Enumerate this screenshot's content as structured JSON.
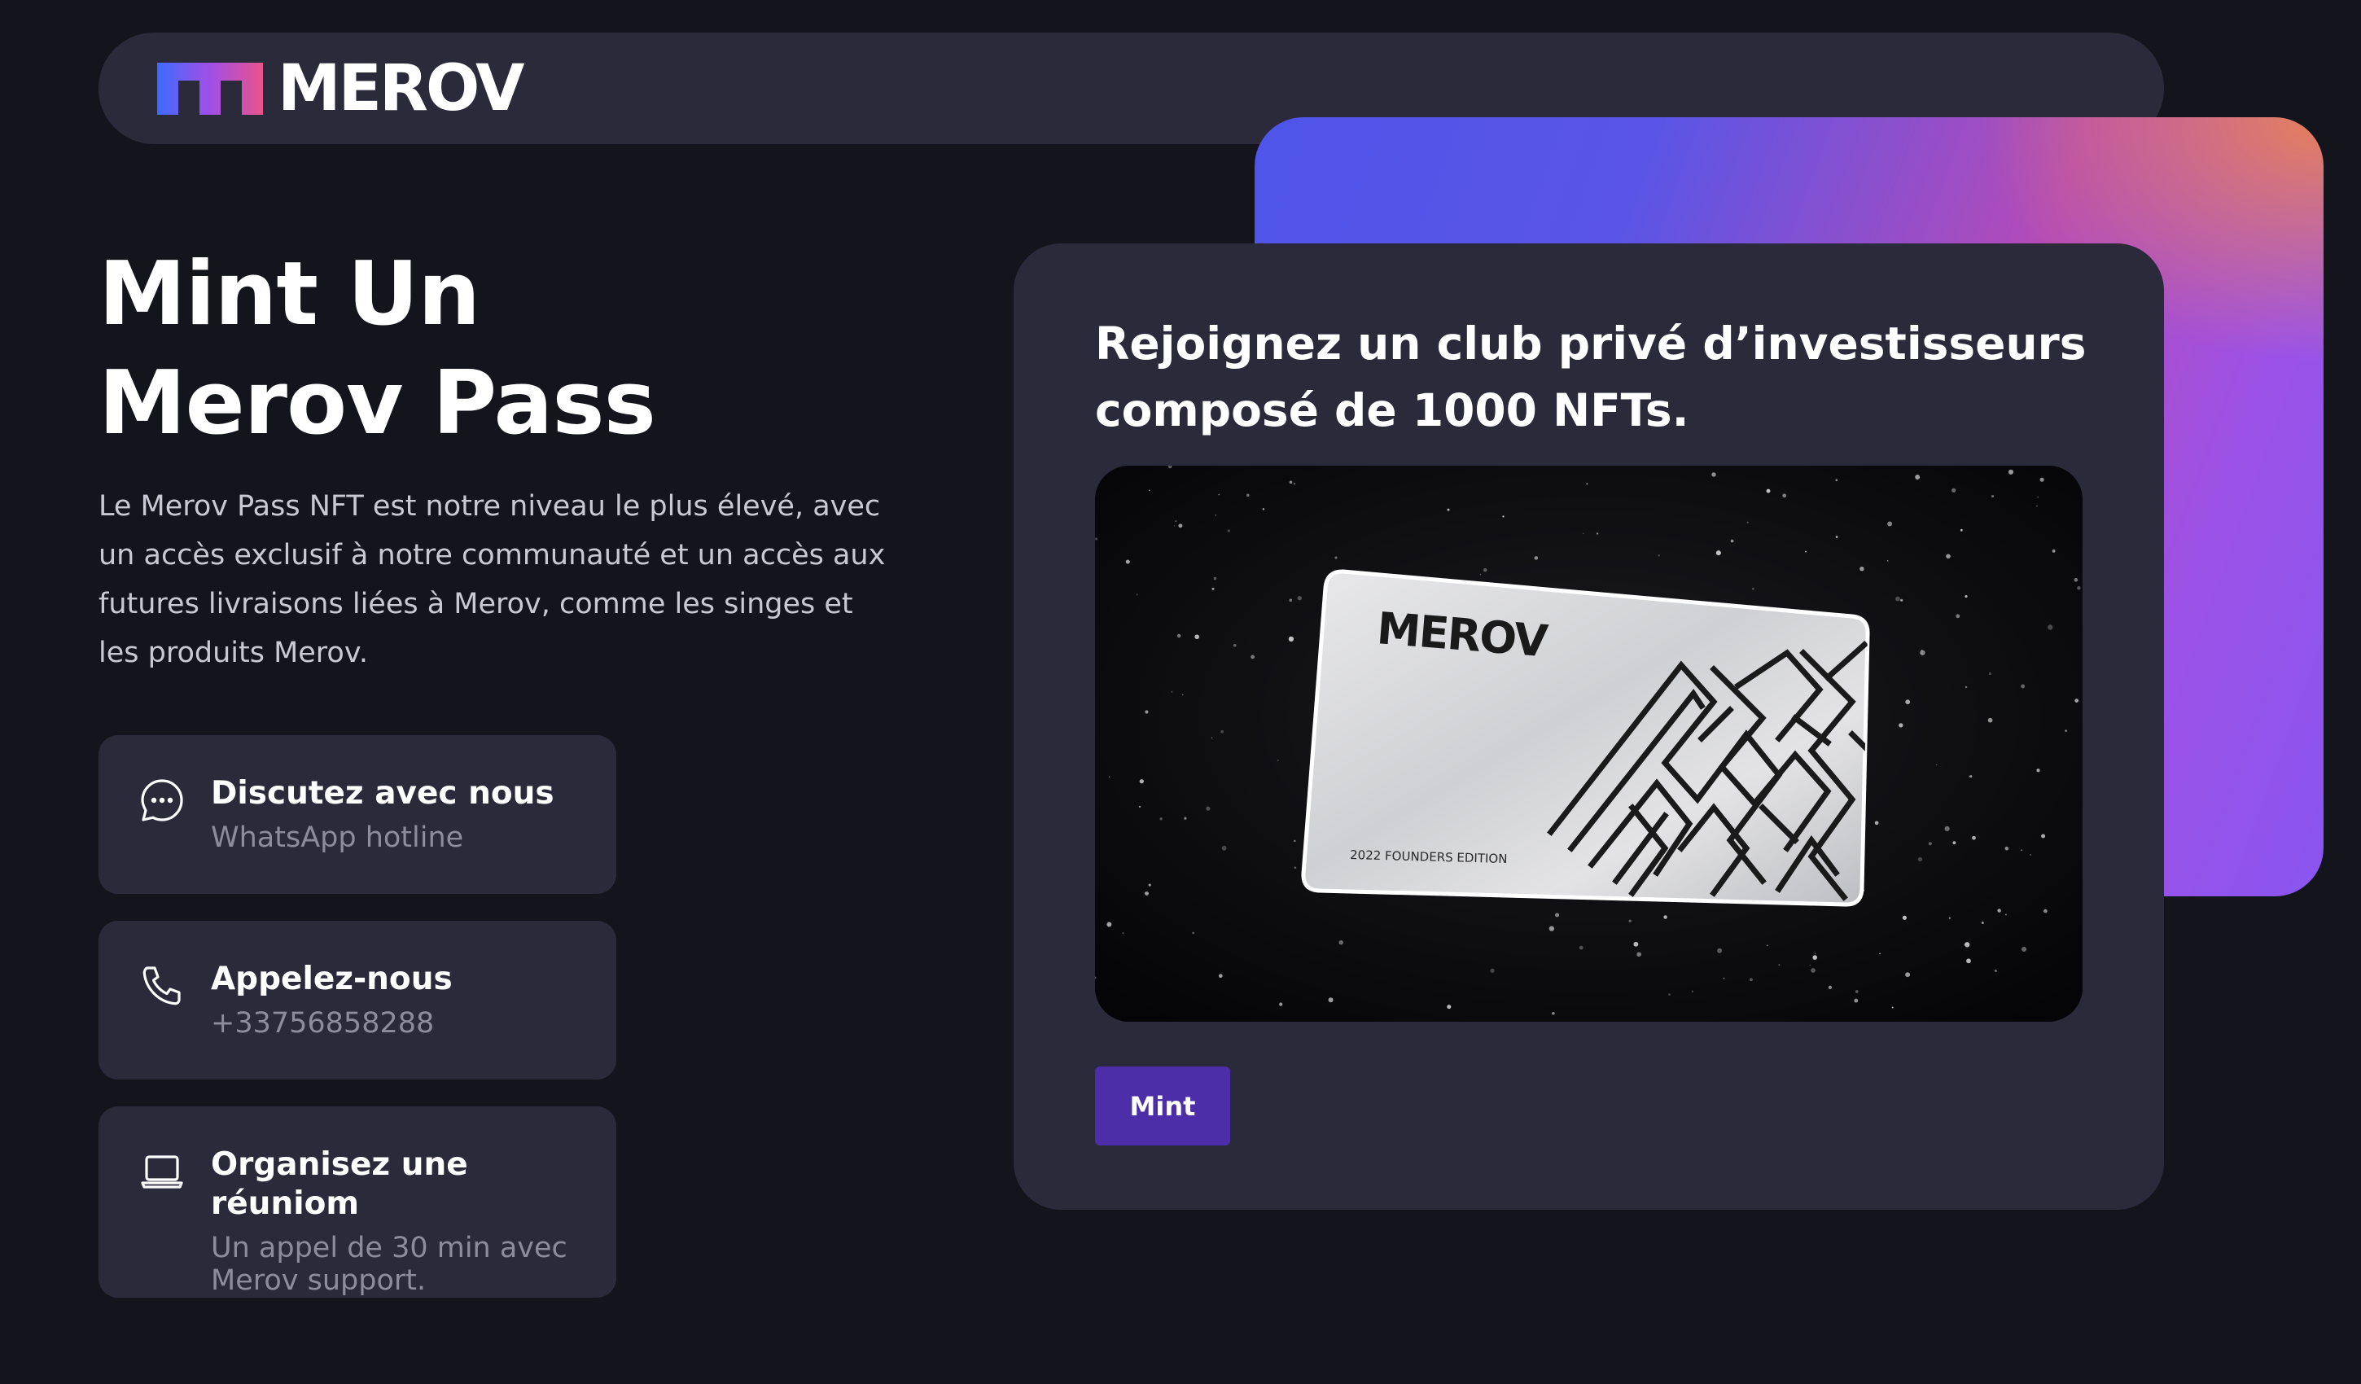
{
  "header": {
    "logo_text": "MEROV",
    "logo_icon": "merov-m-logo-icon"
  },
  "hero": {
    "title_line1": "Mint Un",
    "title_line2": "Merov Pass",
    "description": "Le Merov Pass NFT est notre niveau le plus élevé, avec un accès exclusif à notre communauté et un accès aux futures livraisons liées à Merov, comme les singes et les produits Merov."
  },
  "contacts": [
    {
      "icon": "chat-bubble-icon",
      "title": "Discutez avec nous",
      "subtitle": "WhatsApp hotline"
    },
    {
      "icon": "phone-icon",
      "title": "Appelez-nous",
      "subtitle": "+33756858288"
    },
    {
      "icon": "laptop-icon",
      "title": "Organisez une réuniom",
      "subtitle": "Un appel de 30 min avec Merov support."
    }
  ],
  "mint_card": {
    "heading": "Rejoignez un club privé d’investisseurs composé de 1000 NFTs.",
    "image": {
      "card_brand": "MEROV",
      "card_edition": "2022 FOUNDERS EDITION"
    },
    "button_label": "Mint"
  },
  "colors": {
    "background": "#14151c",
    "surface": "#2b2a3b",
    "accent_button": "#4b2ea8",
    "gradient_blue": "#4f55ea",
    "gradient_pink": "#b54bb8",
    "gradient_orange": "#e6805a",
    "gradient_purple": "#8a55f0",
    "muted_text": "#8d8c9d"
  }
}
